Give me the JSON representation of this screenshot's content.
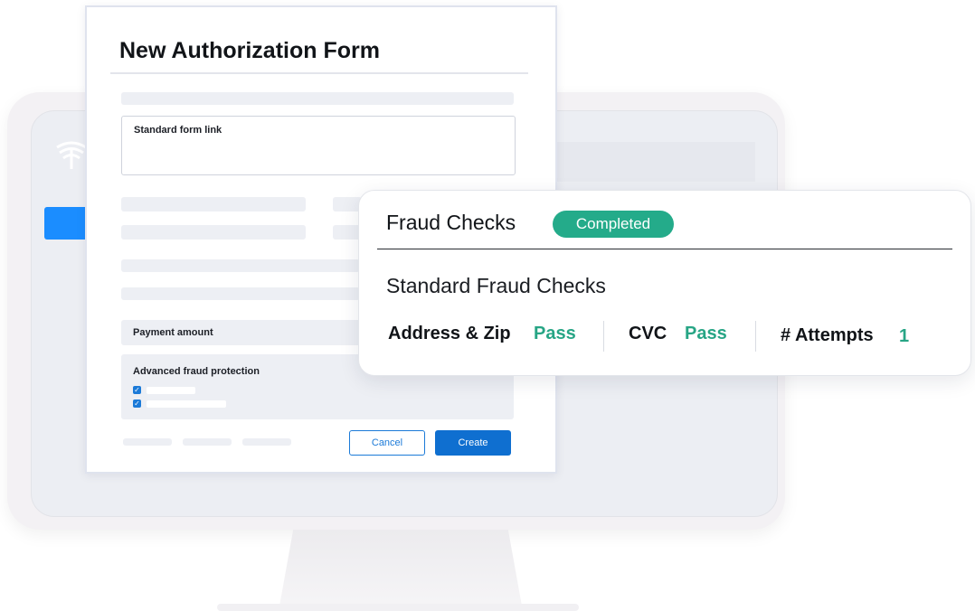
{
  "auth_form": {
    "title": "New Authorization Form",
    "standard_form_link_label": "Standard form link",
    "payment_amount_label": "Payment amount",
    "advanced_fraud_label": "Advanced fraud protection",
    "checkbox_mark": "✓",
    "cancel_label": "Cancel",
    "create_label": "Create"
  },
  "fraud_checks": {
    "title": "Fraud Checks",
    "status": "Completed",
    "subtitle": "Standard Fraud Checks",
    "metrics": [
      {
        "label": "Address & Zip",
        "value": "Pass"
      },
      {
        "label": "CVC",
        "value": "Pass"
      },
      {
        "label": "# Attempts",
        "value": "1"
      }
    ]
  },
  "colors": {
    "accent_blue": "#0f6fd0",
    "success_green": "#24ab8a",
    "pass_text": "#27a585"
  },
  "icons": {
    "screen_logo": "wing-logo-icon",
    "checkbox": "check-icon"
  }
}
